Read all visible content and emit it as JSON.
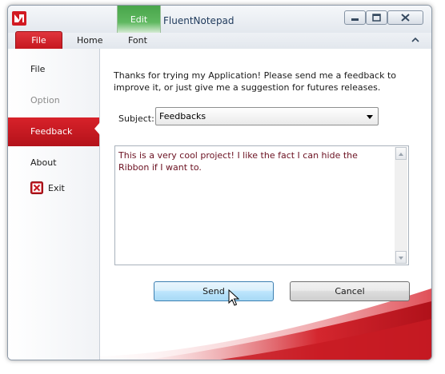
{
  "window": {
    "title": "FluentNotepad",
    "contextual_group": "Edit",
    "controls": [
      "minimize",
      "maximize",
      "close"
    ]
  },
  "ribbon": {
    "file_tab": "File",
    "tabs": [
      "Home",
      "Font"
    ]
  },
  "backstage_menu": {
    "items": [
      {
        "label": "File",
        "state": "normal"
      },
      {
        "label": "Option",
        "state": "disabled"
      },
      {
        "label": "Feedback",
        "state": "active"
      },
      {
        "label": "About",
        "state": "normal"
      }
    ],
    "exit_label": "Exit"
  },
  "feedback": {
    "intro": "Thanks for trying my Application! Please send me a feedback to improve it, or just give me a suggestion for futures releases.",
    "subject_label": "Subject:",
    "subject_value": "Feedbacks",
    "message": "This is a very cool project! I like the fact I can hide the Ribbon if I want to.",
    "send_label": "Send",
    "cancel_label": "Cancel"
  },
  "colors": {
    "accent_red": "#c4161e",
    "contextual_green": "#48a54a",
    "message_text": "#6a1020"
  },
  "icons": {
    "app": "app-icon",
    "exit": "exit-icon",
    "collapse": "chevron-up-icon",
    "pointer": "mouse-pointer-icon"
  }
}
